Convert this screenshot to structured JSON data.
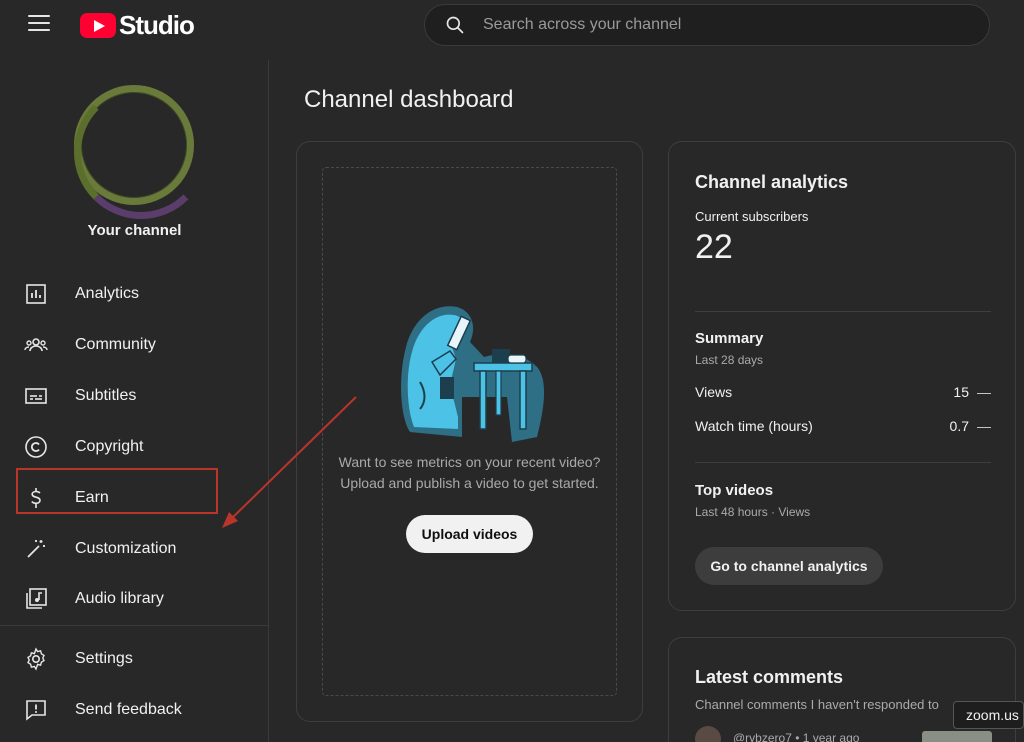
{
  "topbar": {
    "logo_text": "Studio",
    "search_placeholder": "Search across your channel"
  },
  "sidebar": {
    "channel_name": "Your channel",
    "items": [
      {
        "label": "Analytics",
        "icon": "analytics-icon"
      },
      {
        "label": "Community",
        "icon": "community-icon"
      },
      {
        "label": "Subtitles",
        "icon": "subtitles-icon"
      },
      {
        "label": "Copyright",
        "icon": "copyright-icon"
      },
      {
        "label": "Earn",
        "icon": "dollar-icon"
      },
      {
        "label": "Customization",
        "icon": "magic-wand-icon"
      },
      {
        "label": "Audio library",
        "icon": "audio-library-icon"
      }
    ],
    "bottom_items": [
      {
        "label": "Settings",
        "icon": "gear-icon"
      },
      {
        "label": "Send feedback",
        "icon": "feedback-icon"
      }
    ]
  },
  "main": {
    "title": "Channel dashboard",
    "video_card": {
      "prompt_line1": "Want to see metrics on your recent video?",
      "prompt_line2": "Upload and publish a video to get started.",
      "upload_label": "Upload videos"
    },
    "analytics": {
      "title": "Channel analytics",
      "subscribers_label": "Current subscribers",
      "subscribers_count": "22",
      "summary_title": "Summary",
      "summary_period": "Last 28 days",
      "rows": [
        {
          "label": "Views",
          "value": "15",
          "trend": "—"
        },
        {
          "label": "Watch time (hours)",
          "value": "0.7",
          "trend": "—"
        }
      ],
      "top_videos_title": "Top videos",
      "top_videos_period": "Last 48 hours · Views",
      "goto_label": "Go to channel analytics"
    },
    "comments": {
      "title": "Latest comments",
      "subtitle": "Channel comments I haven't responded to",
      "commenter": "@rybzero7 • 1 year ago"
    }
  },
  "tooltip": "zoom.us",
  "colors": {
    "background": "#282828",
    "accent_red": "#ff0033",
    "annotation_red": "#b8352a"
  }
}
